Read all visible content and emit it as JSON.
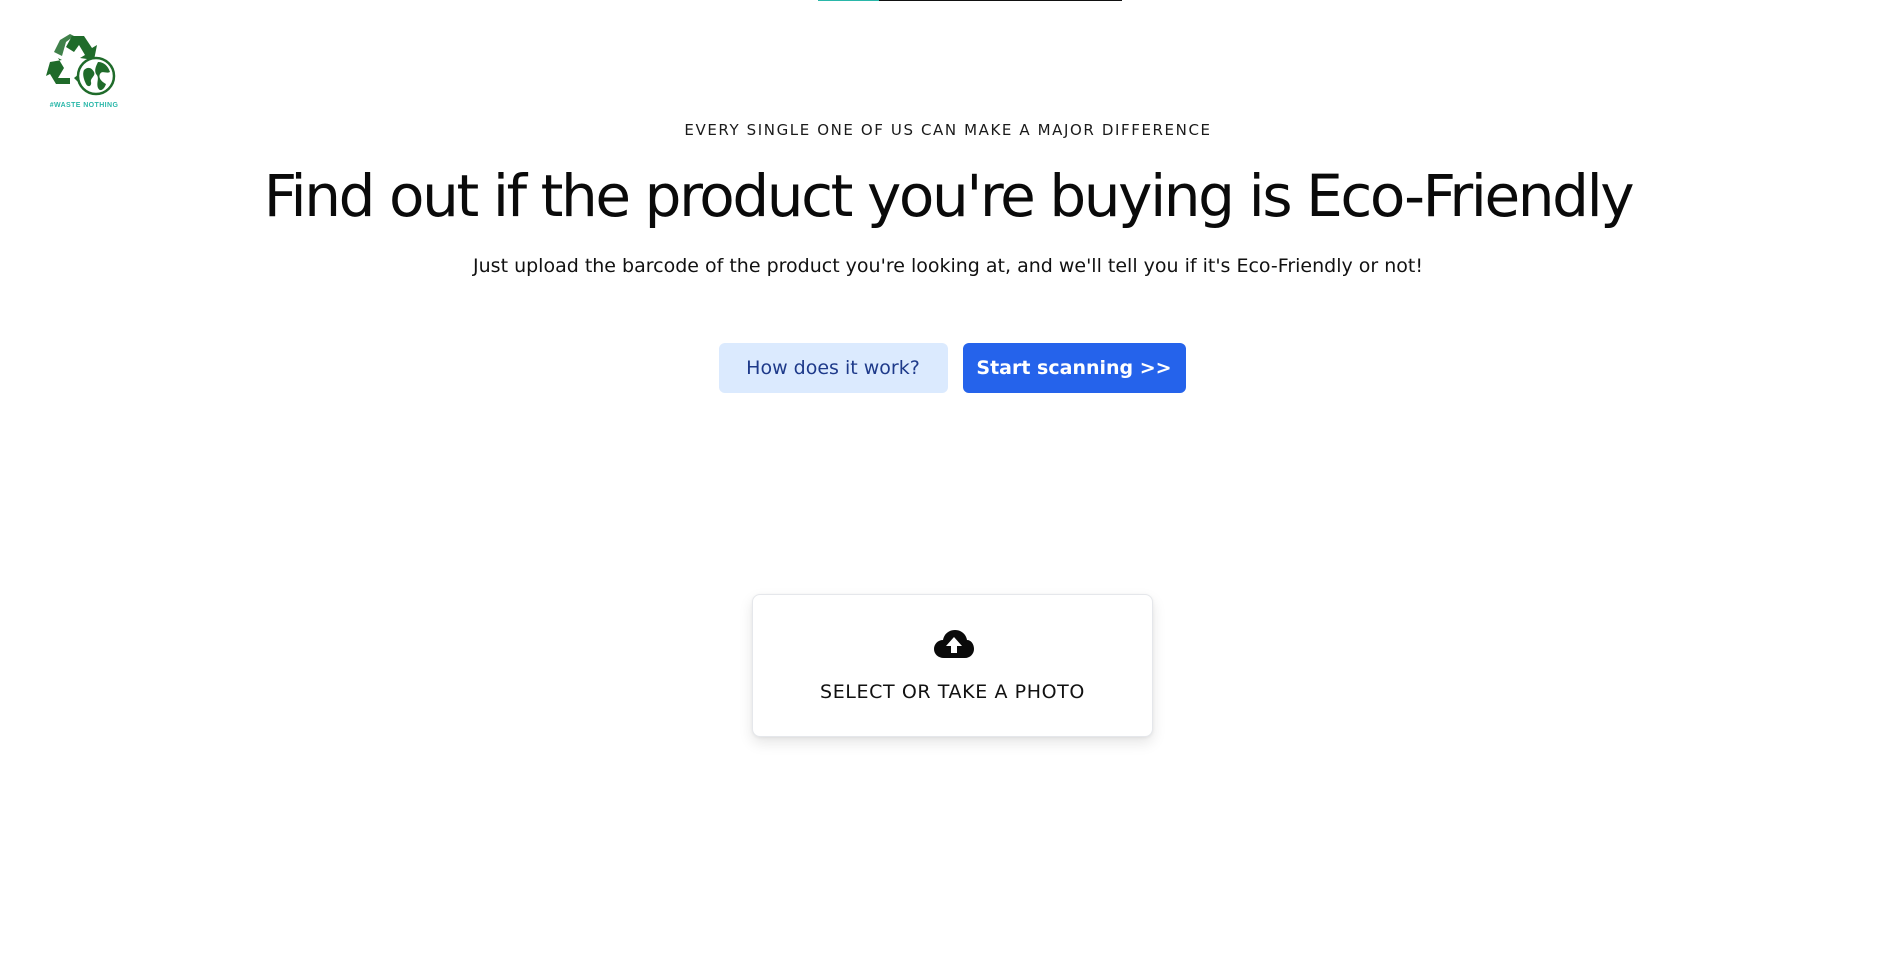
{
  "brand": {
    "tagline": "#WASTE NOTHING",
    "logo_icon": "recycle-globe-icon",
    "logo_color": "#1f6b2a",
    "accent": "#2ab7a9"
  },
  "progress": {
    "fraction": 0.2
  },
  "hero": {
    "eyebrow": "EVERY SINGLE ONE OF US CAN MAKE A MAJOR DIFFERENCE",
    "headline": "Find out if the product you're buying is Eco-Friendly",
    "subtitle": "Just upload the barcode of the product you're looking at, and we'll tell you if it's Eco-Friendly or not!"
  },
  "actions": {
    "how_label": "How does it work?",
    "start_label": "Start scanning >>",
    "primary_color": "#2563eb",
    "secondary_color": "#dbeafe"
  },
  "upload": {
    "icon": "cloud-upload-icon",
    "label": "SELECT OR TAKE A PHOTO"
  }
}
